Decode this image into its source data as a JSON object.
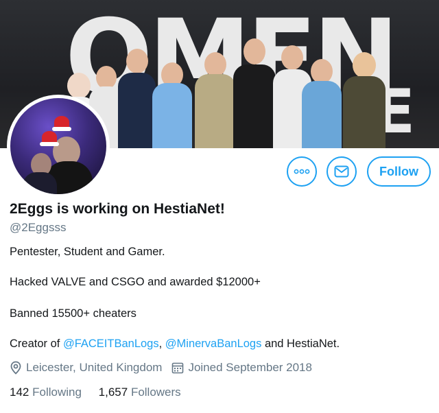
{
  "banner": {
    "logo_text": "OMEN",
    "logo_text_2": "E"
  },
  "colors": {
    "accent": "#1da1f2",
    "secondary_text": "#657786",
    "primary_text": "#14171a"
  },
  "actions": {
    "more_icon": "more-icon",
    "message_icon": "envelope-icon",
    "follow_label": "Follow"
  },
  "profile": {
    "display_name": "2Eggs is working on HestiaNet!",
    "handle": "@2Eggsss",
    "bio": {
      "line1": "Pentester, Student and Gamer.",
      "line2": "Hacked VALVE and CSGO and awarded $12000+",
      "line3": "Banned 15500+ cheaters",
      "line4_prefix": "Creator of ",
      "line4_link1": "@FACEITBanLogs",
      "line4_sep": ", ",
      "line4_link2": "@MinervaBanLogs",
      "line4_suffix": " and HestiaNet."
    },
    "location": "Leicester, United Kingdom",
    "joined": "Joined September 2018",
    "following_count": "142",
    "following_label": "Following",
    "followers_count": "1,657",
    "followers_label": "Followers"
  }
}
